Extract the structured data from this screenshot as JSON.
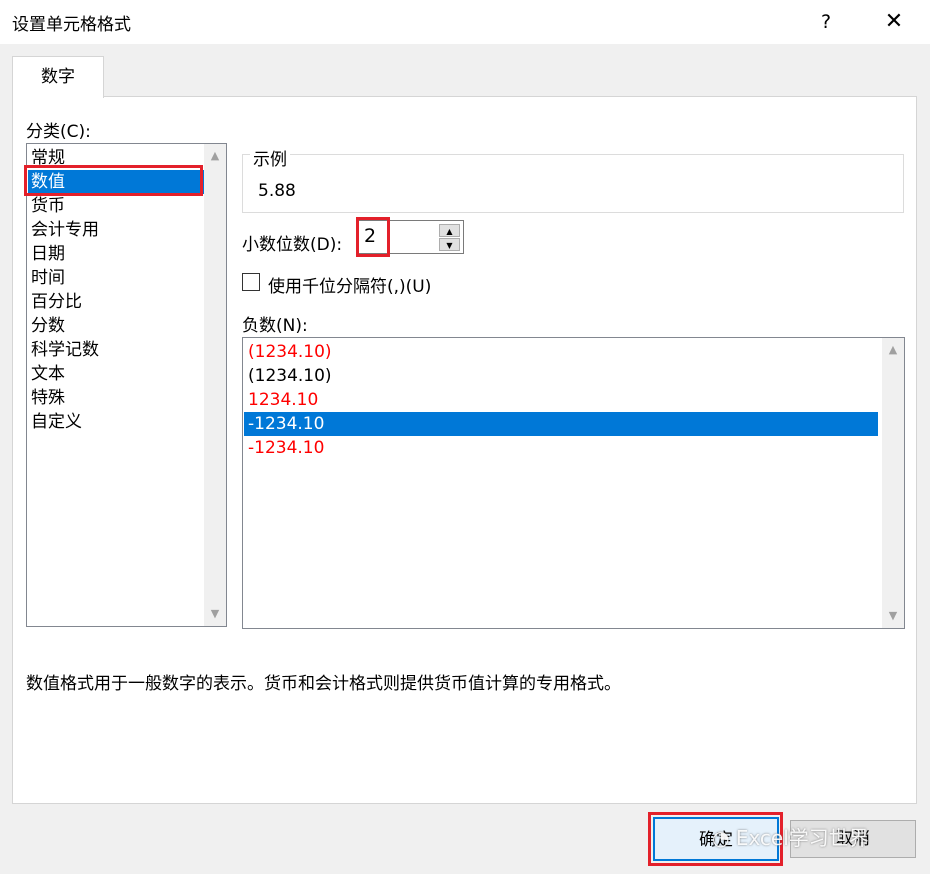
{
  "window": {
    "title": "设置单元格格式",
    "help_glyph": "?",
    "close_glyph": "✕"
  },
  "tabs": [
    {
      "label": "数字",
      "active": true
    }
  ],
  "category": {
    "label": "分类(C):",
    "items": [
      "常规",
      "数值",
      "货币",
      "会计专用",
      "日期",
      "时间",
      "百分比",
      "分数",
      "科学记数",
      "文本",
      "特殊",
      "自定义"
    ],
    "selected": "数值"
  },
  "sample": {
    "legend": "示例",
    "value": "5.88"
  },
  "decimal_places": {
    "label": "小数位数(D):",
    "value": "2"
  },
  "thousands_separator": {
    "label": "使用千位分隔符(,)(U)",
    "checked": false
  },
  "negative_numbers": {
    "label": "负数(N):",
    "items": [
      {
        "text": "(1234.10)",
        "red": true
      },
      {
        "text": "(1234.10)",
        "red": false
      },
      {
        "text": "1234.10",
        "red": true
      },
      {
        "text": "-1234.10",
        "red": false,
        "selected": true
      },
      {
        "text": "-1234.10",
        "red": true
      }
    ]
  },
  "description": "数值格式用于一般数字的表示。货币和会计格式则提供货币值计算的专用格式。",
  "buttons": {
    "ok": "确定",
    "cancel": "取消"
  },
  "watermark": "Excel学习世界",
  "colors": {
    "accent": "#0078d7",
    "highlight_border": "#e3202a",
    "negative_red": "#ff0000"
  }
}
